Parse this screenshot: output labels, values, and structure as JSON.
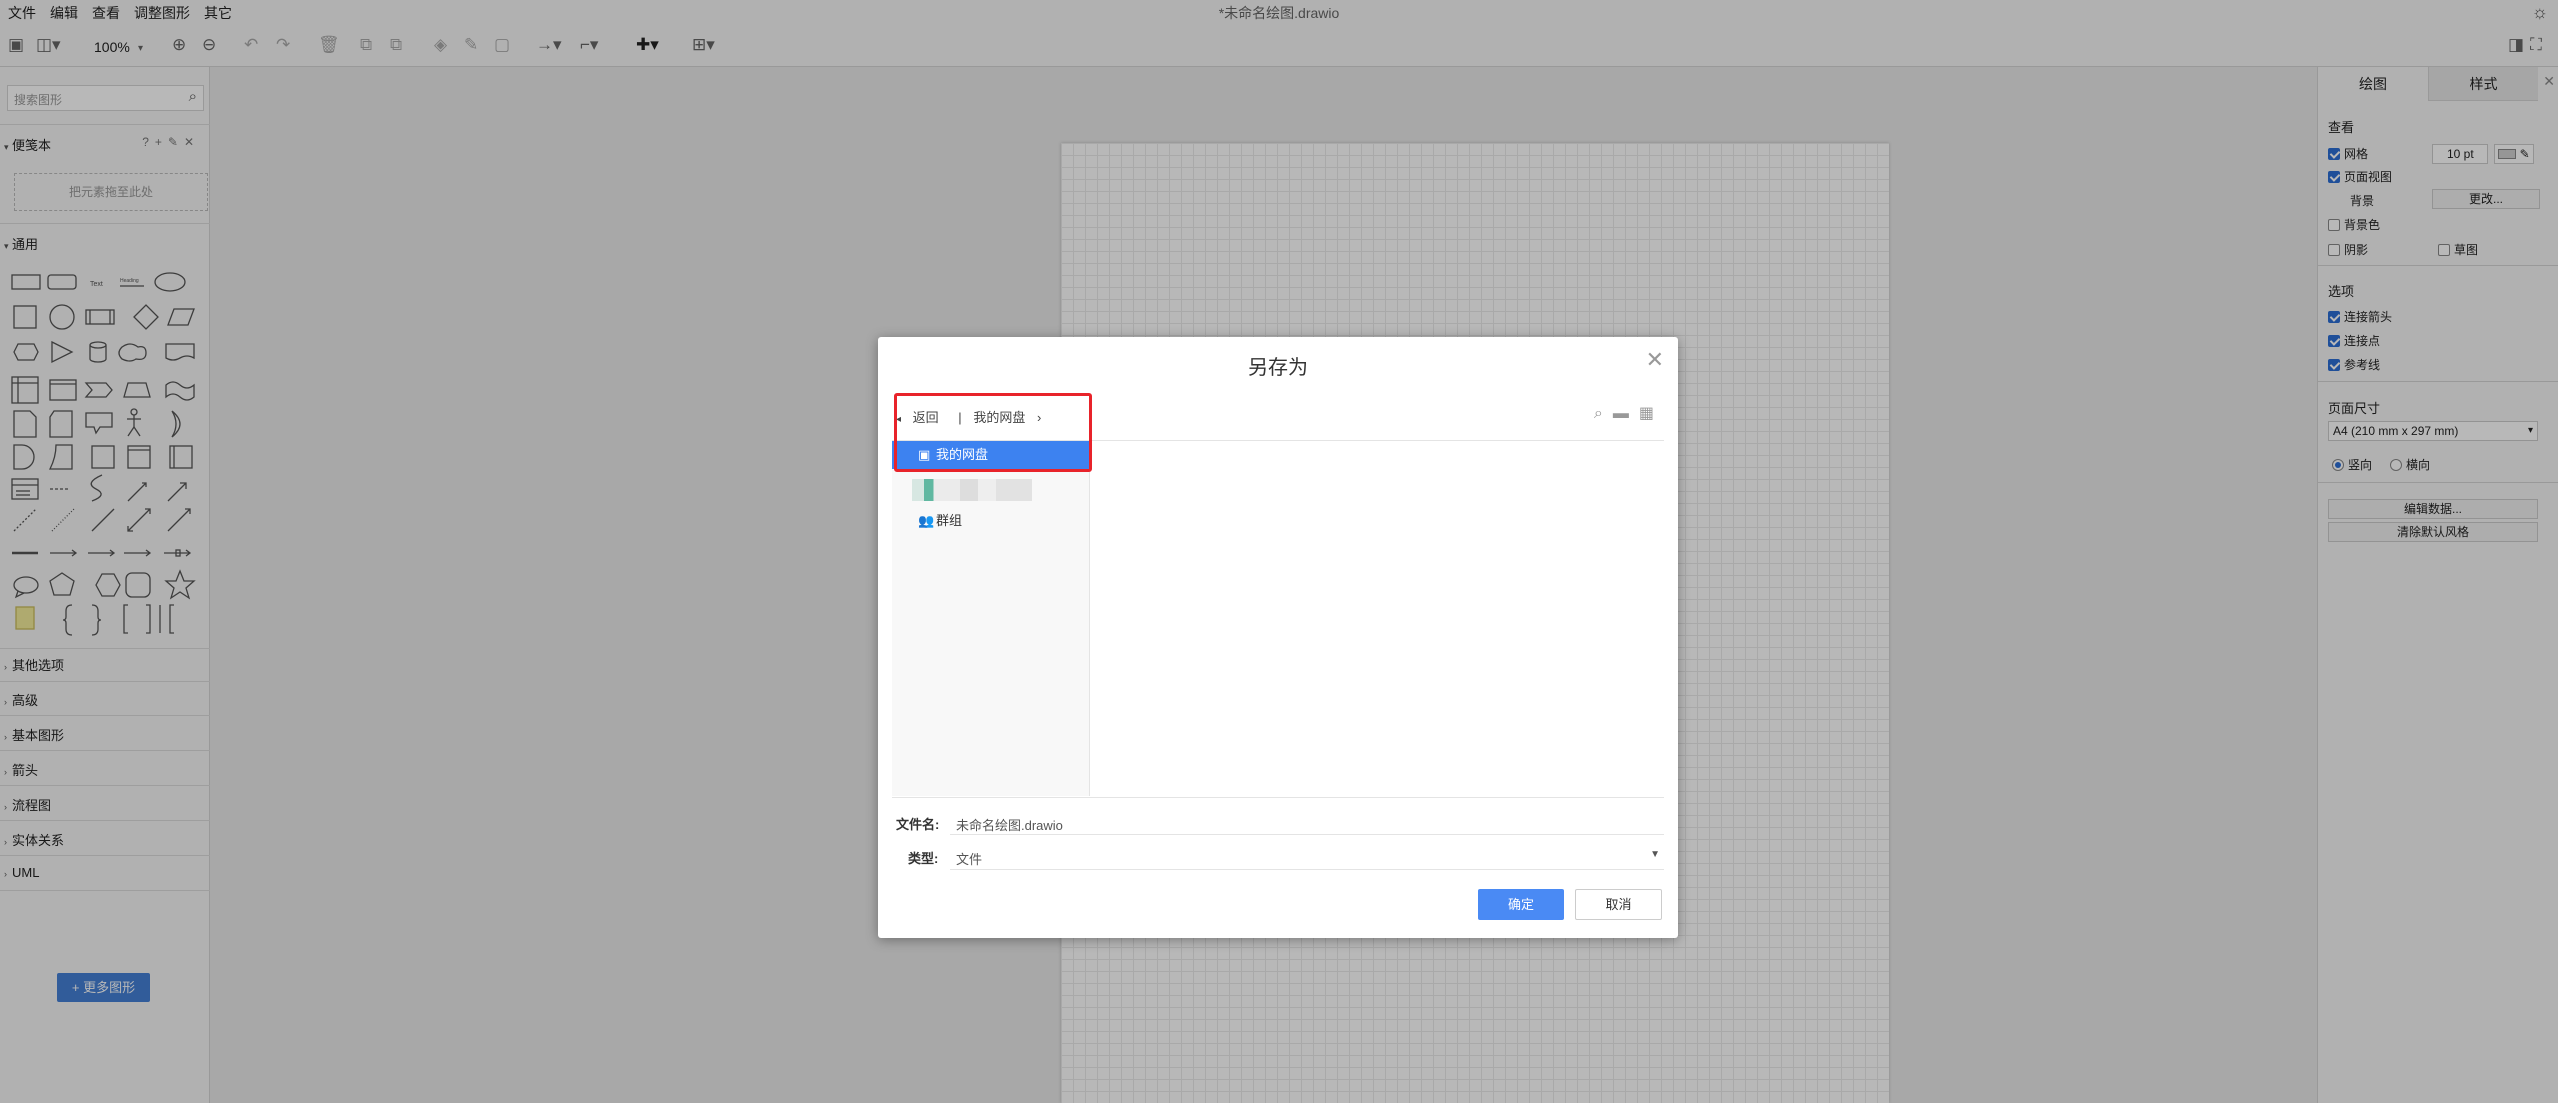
{
  "menubar": {
    "items": [
      "文件",
      "编辑",
      "查看",
      "调整图形",
      "其它"
    ],
    "doc_title": "*未命名绘图.drawio"
  },
  "toolbar": {
    "zoom": "100%"
  },
  "sidebar": {
    "search_placeholder": "搜索图形",
    "scratchpad_label": "便笺本",
    "dropzone_text": "把元素拖至此处",
    "general_label": "通用",
    "sections": [
      "其他选项",
      "高级",
      "基本图形",
      "箭头",
      "流程图",
      "实体关系",
      "UML"
    ],
    "more_shapes_label": "更多图形"
  },
  "format_panel": {
    "tabs": [
      "绘图",
      "样式"
    ],
    "view_heading": "查看",
    "grid_label": "网格",
    "grid_size": "10 pt",
    "page_view_label": "页面视图",
    "background_label": "背景",
    "change_button": "更改...",
    "bg_color_label": "背景色",
    "shadow_label": "阴影",
    "sketch_label": "草图",
    "options_heading": "选项",
    "connection_arrows_label": "连接箭头",
    "connection_points_label": "连接点",
    "guides_label": "参考线",
    "page_size_heading": "页面尺寸",
    "page_size_value": "A4 (210 mm x 297 mm)",
    "portrait_label": "竖向",
    "landscape_label": "横向",
    "edit_data_button": "编辑数据...",
    "clear_style_button": "清除默认风格",
    "checks": {
      "grid": true,
      "page_view": true,
      "bg_color": false,
      "shadow": false,
      "sketch": false,
      "connection_arrows": true,
      "connection_points": true,
      "guides": true
    }
  },
  "dialog": {
    "title": "另存为",
    "back_label": "返回",
    "breadcrumb_sep": "|",
    "breadcrumb_current": "我的网盘",
    "tree": [
      {
        "label": "我的网盘",
        "selected": true
      },
      {
        "label": "群组",
        "selected": false
      }
    ],
    "filename_label": "文件名:",
    "filename_value": "未命名绘图.drawio",
    "type_label": "类型:",
    "type_value": "文件",
    "ok_label": "确定",
    "cancel_label": "取消"
  },
  "colors": {
    "accent": "#4a8af4",
    "selection": "#3d82f0",
    "highlight_box": "#e8232a",
    "more_shapes_button": "#4580d6"
  }
}
